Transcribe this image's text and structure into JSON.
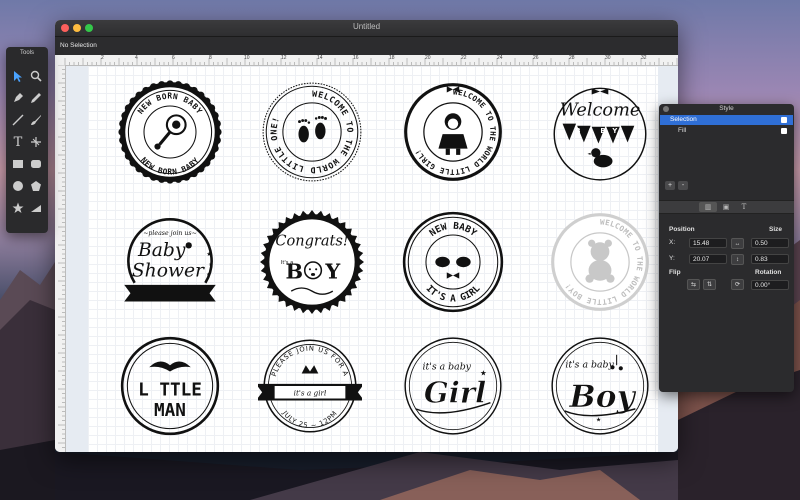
{
  "window": {
    "title": "Untitled",
    "selection_status": "No Selection"
  },
  "ruler": {
    "marks": [
      "2",
      "4",
      "6",
      "8",
      "10",
      "12",
      "14",
      "16",
      "18",
      "20",
      "22",
      "24",
      "26",
      "28",
      "30",
      "32"
    ]
  },
  "tools": {
    "title": "Tools",
    "items": [
      "pointer-icon",
      "zoom-icon",
      "pen-icon",
      "pencil-icon",
      "line-icon",
      "brush-icon",
      "text-icon",
      "transform-icon",
      "rectangle-icon",
      "rounded-rectangle-icon",
      "ellipse-icon",
      "polygon-icon",
      "star-icon",
      "triangle-icon"
    ]
  },
  "badges": {
    "b1": {
      "top": "NEW BORN BABY",
      "bottom": "NEW BORN BABY"
    },
    "b2": {
      "arc": "WELCOME TO THE WORLD LITTLE ONE!"
    },
    "b3": {
      "arc": "WELCOME TO THE WORLD LITTLE GIRL!"
    },
    "b4": {
      "top": "Welcome",
      "flag": "BABY"
    },
    "b5": {
      "small": "~please join us~",
      "line1": "Baby",
      "line2": "Shower"
    },
    "b6": {
      "top": "Congrats!",
      "small": "It's a",
      "letter1": "B",
      "letter2": "Y"
    },
    "b7": {
      "top": "NEW BABY",
      "bottom": "IT'S A GIRL"
    },
    "b8": {
      "arc": "WELCOME TO THE WORLD LITTLE BOY!"
    },
    "b9": {
      "line1": "L TTLE",
      "line2": "MAN"
    },
    "b10": {
      "top": "PLEASE JOIN US FOR A",
      "mid": "it's a girl",
      "bottom": "JULY 25 ~ 12PM"
    },
    "b11": {
      "top": "it's a baby",
      "main": "Girl"
    },
    "b12": {
      "top": "it's a baby",
      "main": "Boy"
    }
  },
  "style_panel": {
    "title": "Style",
    "rows": [
      {
        "label": "Selection",
        "selected": true
      },
      {
        "label": "Fill",
        "selected": false
      }
    ],
    "add_label": "+",
    "remove_label": "-",
    "tabs": [
      "geometry-tab-icon",
      "image-tab-icon",
      "text-tab-icon"
    ],
    "position_label": "Position",
    "size_label": "Size",
    "x_label": "X:",
    "y_label": "Y:",
    "x_value": "15.48",
    "y_value": "20.07",
    "width_value": "0.50",
    "height_value": "0.83",
    "flip_label": "Flip",
    "rotation_label": "Rotation",
    "rotation_value": "0.00°"
  }
}
